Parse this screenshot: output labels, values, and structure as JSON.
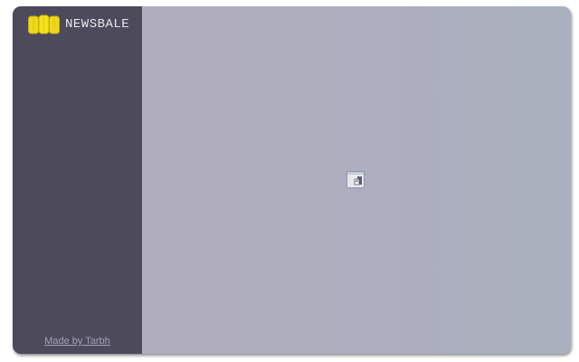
{
  "app": {
    "brand_name": "NEWSBALE",
    "logo_icon": "bale-icon",
    "brand_color": "#f6e21c"
  },
  "sidebar": {
    "background": "#4d4a5c",
    "credit_text": "Made by Tarbh"
  },
  "main": {
    "background": "#aeadbd",
    "center_icon": "broken-image-icon"
  }
}
